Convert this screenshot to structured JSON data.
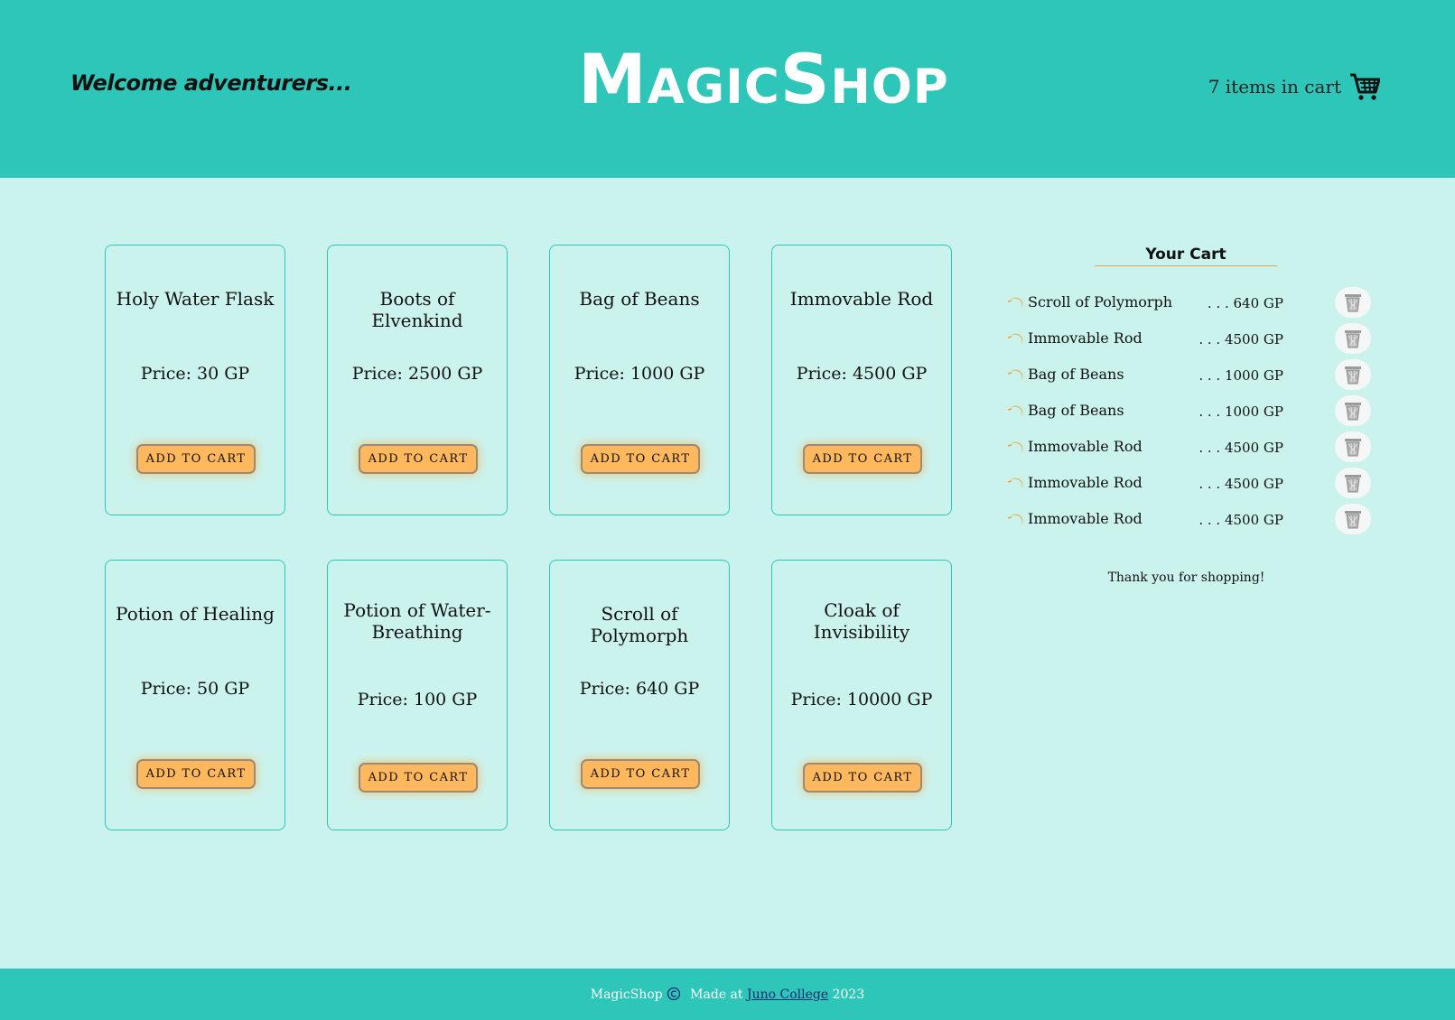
{
  "header": {
    "welcome": "Welcome adventurers...",
    "logo": "MagicShop",
    "cart_status": "7 items in cart",
    "cart_icon": "shopping-cart-icon"
  },
  "products": [
    {
      "name": "Holy Water Flask",
      "price": "Price: 30 GP",
      "button": "ADD TO CART"
    },
    {
      "name": "Boots of Elvenkind",
      "price": "Price: 2500 GP",
      "button": "ADD TO CART"
    },
    {
      "name": "Bag of Beans",
      "price": "Price: 1000 GP",
      "button": "ADD TO CART"
    },
    {
      "name": "Immovable Rod",
      "price": "Price: 4500 GP",
      "button": "ADD TO CART"
    },
    {
      "name": "Potion of Healing",
      "price": "Price: 50 GP",
      "button": "ADD TO CART"
    },
    {
      "name": "Potion of Water-Breathing",
      "price": "Price: 100 GP",
      "button": "ADD TO CART"
    },
    {
      "name": "Scroll of Polymorph",
      "price": "Price: 640 GP",
      "button": "ADD TO CART"
    },
    {
      "name": "Cloak of Invisibility",
      "price": "Price: 10000 GP",
      "button": "ADD TO CART"
    }
  ],
  "cart": {
    "title": "Your Cart",
    "items": [
      {
        "name": "Scroll of Polymorph",
        "price": ". . . 640 GP"
      },
      {
        "name": "Immovable Rod",
        "price": ". . . 4500 GP"
      },
      {
        "name": "Bag of Beans",
        "price": ". . . 1000 GP"
      },
      {
        "name": "Bag of Beans",
        "price": ". . . 1000 GP"
      },
      {
        "name": "Immovable Rod",
        "price": ". . . 4500 GP"
      },
      {
        "name": "Immovable Rod",
        "price": ". . . 4500 GP"
      },
      {
        "name": "Immovable Rod",
        "price": ". . . 4500 GP"
      }
    ],
    "bullet_icon": "crescent-moon-icon",
    "remove_icon": "trash-icon",
    "thanks": "Thank you for shopping!"
  },
  "footer": {
    "brand": "MagicShop",
    "made_at": "Made at",
    "link": "Juno College",
    "year": "2023",
    "copyright_icon": "copyright-icon"
  },
  "colors": {
    "header": "#2ec6b8",
    "background": "#cbf3ee",
    "button": "#ffb85e",
    "accent": "#e8a247"
  }
}
